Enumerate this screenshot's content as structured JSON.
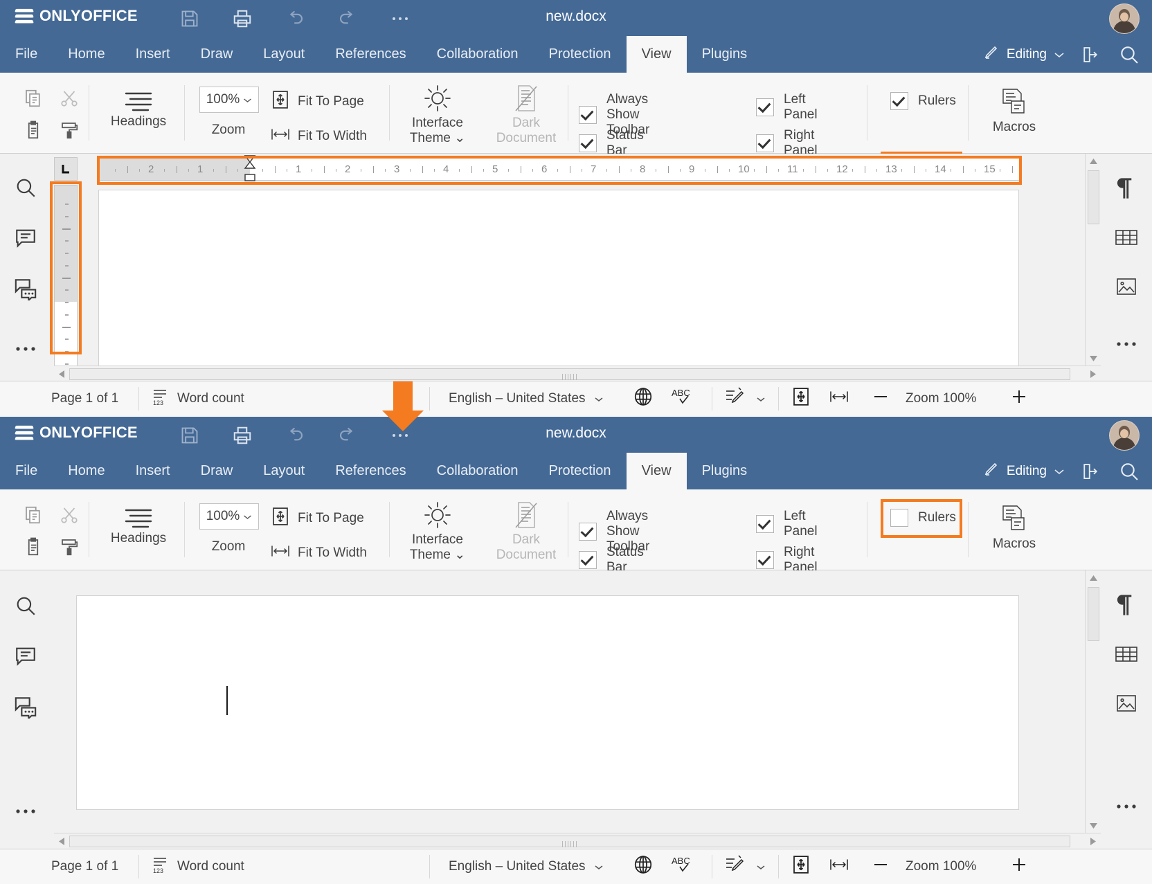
{
  "brand": {
    "name": "ONLYOFFICE",
    "accent": "#f47b20",
    "header_bg": "#446995"
  },
  "titlebar": {
    "doc_title": "new.docx",
    "icons": [
      "save-icon",
      "print-icon",
      "undo-icon",
      "redo-icon",
      "more-icon"
    ]
  },
  "tabs": [
    {
      "label": "File",
      "active": false
    },
    {
      "label": "Home",
      "active": false
    },
    {
      "label": "Insert",
      "active": false
    },
    {
      "label": "Draw",
      "active": false
    },
    {
      "label": "Layout",
      "active": false
    },
    {
      "label": "References",
      "active": false
    },
    {
      "label": "Collaboration",
      "active": false
    },
    {
      "label": "Protection",
      "active": false
    },
    {
      "label": "View",
      "active": true
    },
    {
      "label": "Plugins",
      "active": false
    }
  ],
  "tab_right": {
    "editing_label": "Editing"
  },
  "ribbon": {
    "headings_label": "Headings",
    "zoom_value": "100%",
    "zoom_label": "Zoom",
    "fit_to_page": "Fit To Page",
    "fit_to_width": "Fit To Width",
    "interface_theme_line1": "Interface",
    "interface_theme_line2": "Theme",
    "dark_document_line1": "Dark",
    "dark_document_line2": "Document",
    "macros_label": "Macros",
    "checkboxes_top": [
      {
        "label": "Always Show Toolbar",
        "checked": true
      },
      {
        "label": "Status Bar",
        "checked": true
      },
      {
        "label": "Left Panel",
        "checked": true
      },
      {
        "label": "Right Panel",
        "checked": true
      },
      {
        "label": "Rulers",
        "checked": true
      }
    ],
    "checkboxes_bottom": [
      {
        "label": "Always Show Toolbar",
        "checked": true
      },
      {
        "label": "Status Bar",
        "checked": true
      },
      {
        "label": "Left Panel",
        "checked": true
      },
      {
        "label": "Right Panel",
        "checked": true
      },
      {
        "label": "Rulers",
        "checked": false
      }
    ]
  },
  "left_panel_icons": [
    "search-icon",
    "comment-icon",
    "chat-icon",
    "more-icon"
  ],
  "right_panel_icons": [
    "paragraph-settings-icon",
    "table-settings-icon",
    "image-settings-icon",
    "more-icon"
  ],
  "ruler": {
    "tab_stop_marker": "left-tab-stop",
    "left_labels": [
      "2",
      "1"
    ],
    "right_labels": [
      "1",
      "2",
      "3",
      "4",
      "5",
      "6",
      "7",
      "8",
      "9",
      "10",
      "11",
      "12",
      "13",
      "14",
      "15"
    ],
    "vertical_labels": []
  },
  "statusbar": {
    "page_label": "Page 1 of 1",
    "word_count_label": "Word count",
    "language": "English – United States",
    "zoom_label": "Zoom 100%",
    "icons": [
      "word-count-icon",
      "globe-icon",
      "spellcheck-icon",
      "track-changes-icon",
      "fit-page-icon",
      "fit-width-icon",
      "zoom-out-icon",
      "zoom-in-icon"
    ]
  },
  "annotation": {
    "arrow": "down-arrow",
    "highlight_color": "#f47b20"
  }
}
